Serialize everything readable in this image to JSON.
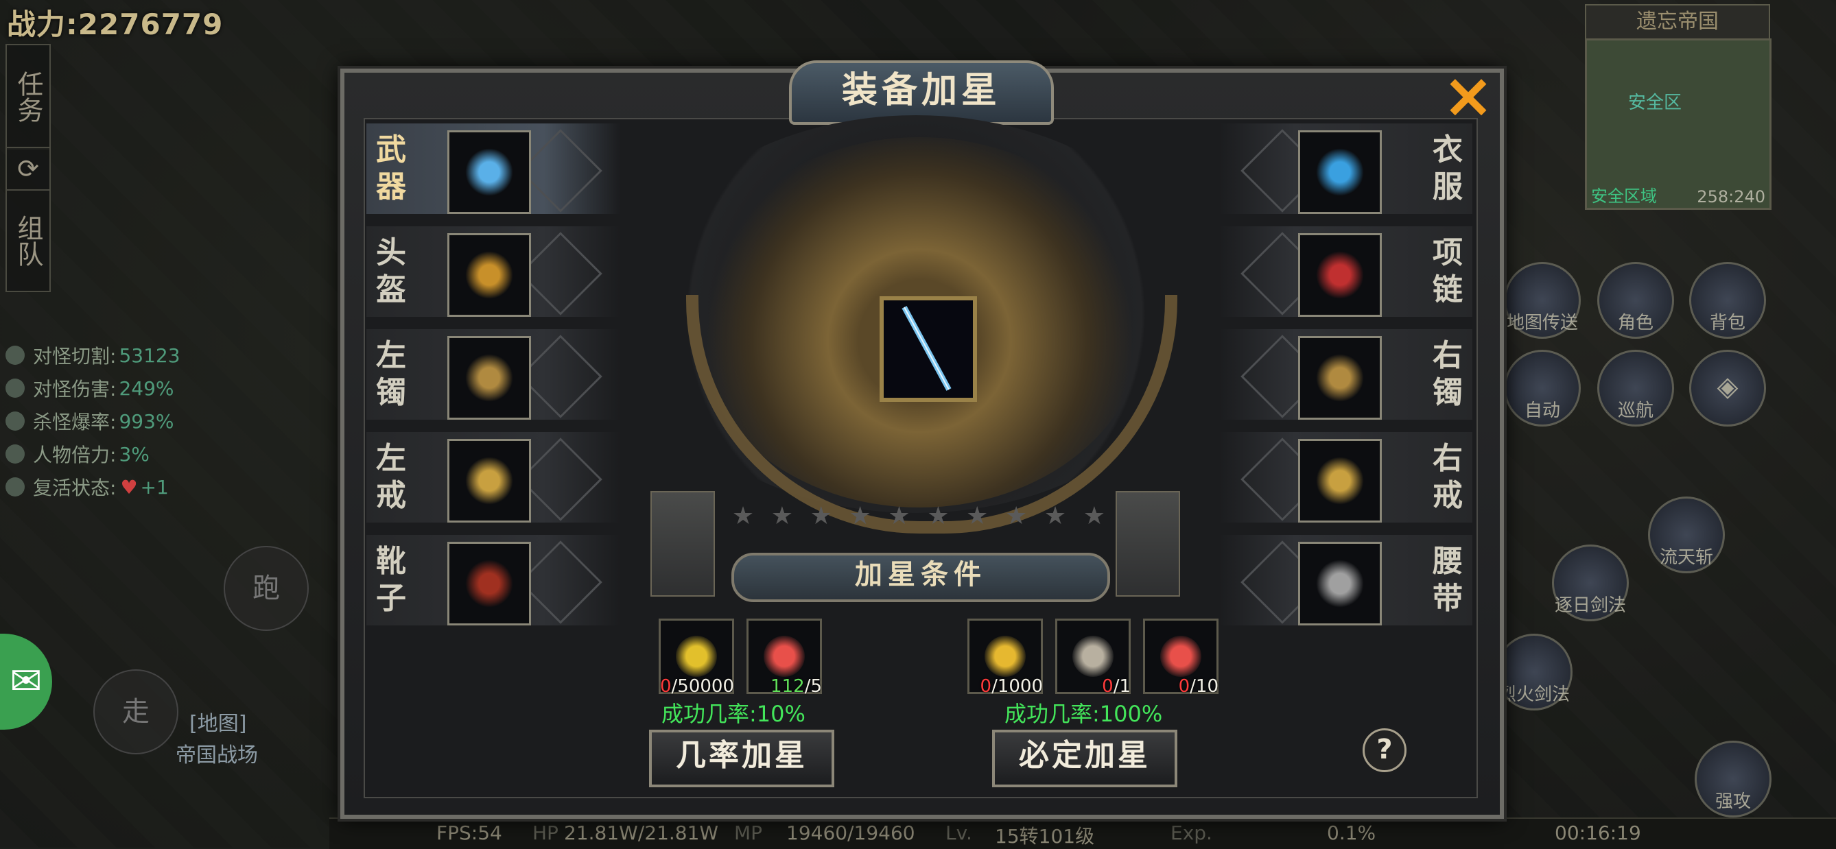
{
  "hud": {
    "power": "战力:2276779",
    "side_buttons": [
      "任务",
      "组队"
    ],
    "stats": [
      {
        "label": "对怪切割:",
        "value": "53123"
      },
      {
        "label": "对怪伤害:",
        "value": "249%"
      },
      {
        "label": "杀怪爆率:",
        "value": "993%"
      },
      {
        "label": "人物倍力:",
        "value": "3%"
      },
      {
        "label": "复活状态:",
        "value": "+1"
      }
    ],
    "minimap": {
      "title": "遗忘帝国",
      "safe_label": "安全区",
      "zone": "安全区域",
      "coord": "258:240"
    },
    "right_buttons": [
      "地图传送",
      "角色",
      "背包",
      "自动",
      "巡航"
    ],
    "skills": [
      "流天斩",
      "逐日剑法",
      "烈火剑法",
      "强攻"
    ],
    "left_controls": {
      "run": "跑",
      "walk": "走",
      "map_link": "[地图]",
      "map_name": "帝国战场"
    },
    "bottom": {
      "fps": "FPS:54",
      "hp_label": "HP",
      "hp": "21.81W/21.81W",
      "mp_label": "MP",
      "mp": "19460/19460",
      "lv_label": "Lv.",
      "level": "15转101级",
      "exp_label": "Exp.",
      "exp": "0.1%",
      "time": "00:16:19"
    }
  },
  "panel": {
    "title": "装备加星",
    "close": "×",
    "left_slots": [
      {
        "label": "武器",
        "active": true,
        "color": "#5ab0e8"
      },
      {
        "label": "头盔",
        "active": false,
        "color": "#c8902a"
      },
      {
        "label": "左镯",
        "active": false,
        "color": "#b08a40"
      },
      {
        "label": "左戒",
        "active": false,
        "color": "#c8a040"
      },
      {
        "label": "靴子",
        "active": false,
        "color": "#a03020"
      }
    ],
    "right_slots": [
      {
        "label": "衣服",
        "color": "#3aa0e0"
      },
      {
        "label": "项链",
        "color": "#c03030"
      },
      {
        "label": "右镯",
        "color": "#b08a40"
      },
      {
        "label": "右戒",
        "color": "#c8a040"
      },
      {
        "label": "腰带",
        "color": "#a0a0a0"
      }
    ],
    "stars_total": 10,
    "stars_filled": 0,
    "conditions_title": "加星条件",
    "chance": {
      "materials": [
        {
          "icon": "gold-pile-icon",
          "color": "#e2c02c",
          "have": "0",
          "need": "/50000",
          "met": false
        },
        {
          "icon": "red-orb-icon",
          "color": "#e8504a",
          "have": "112",
          "need": "/5",
          "met": true
        }
      ],
      "rate": "成功几率:10%",
      "button": "几率加星"
    },
    "sure": {
      "materials": [
        {
          "icon": "gold-ingot-icon",
          "color": "#e6b830",
          "have": "0",
          "need": "/1000",
          "met": false
        },
        {
          "icon": "hammer-icon",
          "color": "#b8b0a0",
          "have": "0",
          "need": "/1",
          "met": false
        },
        {
          "icon": "red-orb-icon",
          "color": "#e8504a",
          "have": "0",
          "need": "/10",
          "met": false
        }
      ],
      "rate": "成功几率:100%",
      "button": "必定加星"
    },
    "help": "?"
  }
}
